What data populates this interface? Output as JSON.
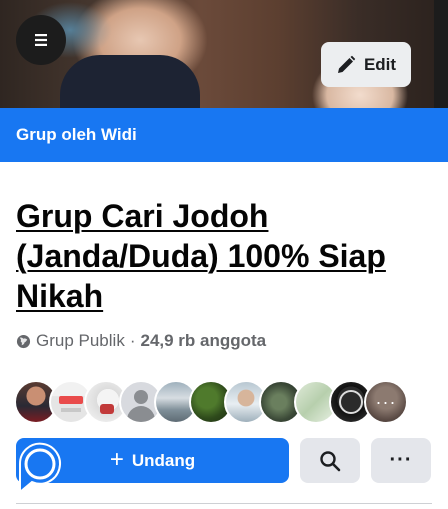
{
  "header": {
    "menu_icon": "hamburger-menu-icon",
    "edit_label": "Edit",
    "edit_icon": "pencil-icon"
  },
  "group_bar": {
    "label": "Grup oleh Widi"
  },
  "group": {
    "title": "Grup Cari Jodoh (Janda/Duda) 100% Siap Nikah",
    "privacy": "Grup Publik",
    "separator": "·",
    "members": "24,9 rb anggota"
  },
  "actions": {
    "invite_label": "Undang",
    "invite_icon": "plus-icon",
    "search_icon": "search-icon",
    "more_label": "···"
  },
  "colors": {
    "brand_blue": "#1877f2",
    "button_gray": "#e4e6eb"
  }
}
